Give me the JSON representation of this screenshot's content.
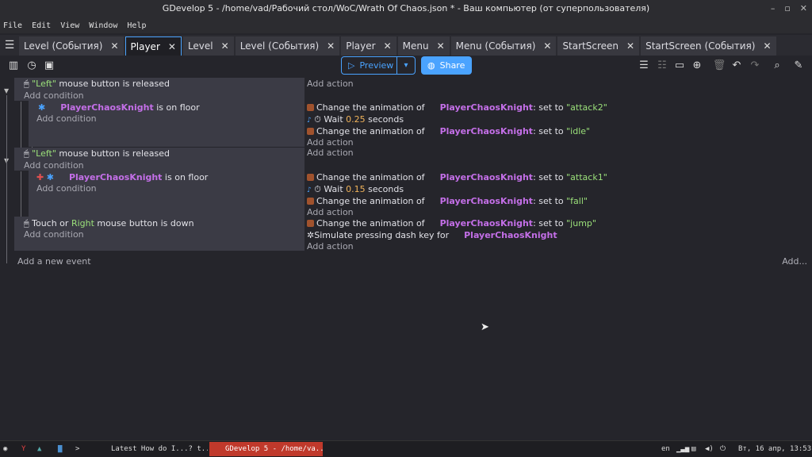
{
  "window": {
    "title": "GDevelop 5 - /home/vad/Рабочий стол/WoC/Wrath Of Chaos.json * - Ваш компьютер (от суперпользователя)",
    "controls": [
      "–",
      "▫",
      "✕"
    ]
  },
  "menu": [
    "File",
    "Edit",
    "View",
    "Window",
    "Help"
  ],
  "tabs": [
    {
      "label": "Level (События)",
      "active": false
    },
    {
      "label": "Player",
      "active": true
    },
    {
      "label": "Level",
      "active": false
    },
    {
      "label": "Level (События)",
      "active": false
    },
    {
      "label": "Player",
      "active": false
    },
    {
      "label": "Menu",
      "active": false
    },
    {
      "label": "Menu (События)",
      "active": false
    },
    {
      "label": "StartScreen",
      "active": false
    },
    {
      "label": "StartScreen (События)",
      "active": false
    }
  ],
  "toolbar": {
    "preview_label": "Preview",
    "share_label": "Share"
  },
  "events": {
    "e1": {
      "cond_quote": "\"Left\"",
      "cond_rest": " mouse button is released",
      "add_condition": "Add condition",
      "add_action": "Add action"
    },
    "e1s": {
      "obj": "PlayerChaosKnight",
      "cond_rest": " is on floor",
      "add_condition": "Add condition",
      "actions": {
        "a1_pre": "Change the animation of",
        "a1_obj": "PlayerChaosKnight",
        "a1_mid": ": set to ",
        "a1_val": "\"attack2\"",
        "a2_pre": "Wait ",
        "a2_num": "0.25",
        "a2_post": " seconds",
        "a3_pre": "Change the animation of",
        "a3_obj": "PlayerChaosKnight",
        "a3_mid": ": set to ",
        "a3_val": "\"idle\""
      },
      "add_action": "Add action"
    },
    "e2": {
      "cond_quote": "\"Left\"",
      "cond_rest": " mouse button is released",
      "add_condition": "Add condition",
      "add_action": "Add action"
    },
    "e2s": {
      "obj": "PlayerChaosKnight",
      "cond_rest": " is on floor",
      "add_condition": "Add condition",
      "actions": {
        "a1_pre": "Change the animation of",
        "a1_obj": "PlayerChaosKnight",
        "a1_mid": ": set to ",
        "a1_val": "\"attack1\"",
        "a2_pre": "Wait ",
        "a2_num": "0.15",
        "a2_post": " seconds",
        "a3_pre": "Change the animation of",
        "a3_obj": "PlayerChaosKnight",
        "a3_mid": ": set to ",
        "a3_val": "\"fall\""
      },
      "add_action": "Add action"
    },
    "e3": {
      "cond_pre": "Touch or ",
      "cond_green": "Right",
      "cond_rest": " mouse button is down",
      "add_condition": "Add condition",
      "actions": {
        "a1_pre": "Change the animation of",
        "a1_obj": "PlayerChaosKnight",
        "a1_mid": ": set to ",
        "a1_val": "\"jump\"",
        "a2_pre": "Simulate pressing dash key for",
        "a2_obj": "PlayerChaosKnight"
      },
      "add_action": "Add action"
    },
    "add_event": "Add a new event",
    "add_more": "Add..."
  },
  "taskbar": {
    "task1": "Latest How do I...? t...",
    "task2": "GDevelop 5 - /home/va...",
    "lang": "en",
    "clock": "Вт, 16 апр, 13:53"
  },
  "colors": {
    "accent": "#4aa3ff",
    "object": "#c46fe8",
    "string": "#9be07a",
    "number": "#f0b35a",
    "task_active": "#c0392b"
  }
}
